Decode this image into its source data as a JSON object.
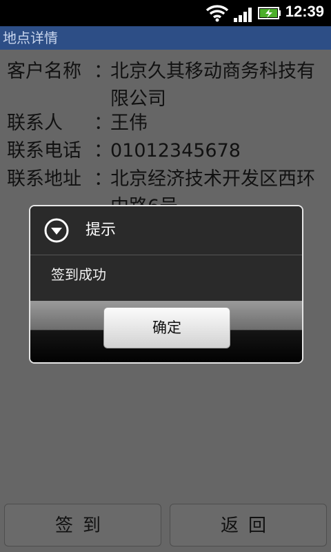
{
  "status_bar": {
    "time": "12:39",
    "icons": [
      "wifi-icon",
      "signal-icon",
      "battery-charging-icon"
    ]
  },
  "app": {
    "title": "地点详情"
  },
  "details": {
    "customer": {
      "label": "客户名称",
      "colon": "：",
      "value": "北京久其移动商务科技有限公司"
    },
    "contact": {
      "label": "联系人",
      "colon": "：",
      "value": "王伟"
    },
    "phone": {
      "label": "联系电话",
      "colon": "：",
      "value": "01012345678"
    },
    "address": {
      "label": "联系地址",
      "colon": "：",
      "value": "北京经济技术开发区西环中路6号"
    }
  },
  "buttons": {
    "checkin": "签到",
    "back": "返回"
  },
  "dialog": {
    "title": "提示",
    "message": "签到成功",
    "confirm": "确定",
    "icon": "chevron-down-circle-icon"
  },
  "colors": {
    "title_bar": "#2d4e86",
    "overlay": "#666666"
  }
}
